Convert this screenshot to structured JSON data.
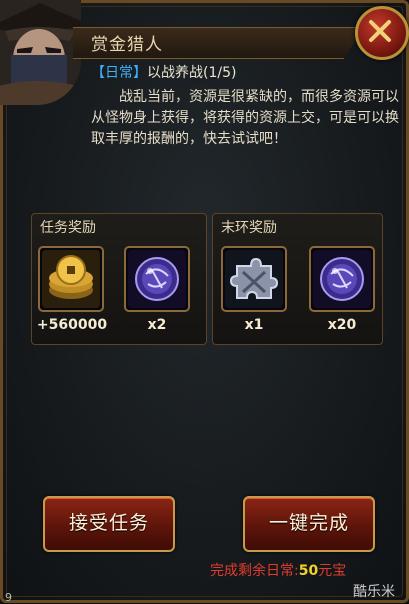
{
  "header": {
    "title": "赏金猎人"
  },
  "quest": {
    "type": "【日常】",
    "name": "以战养战",
    "progress": "(1/5)",
    "description": "战乱当前，资源是很紧缺的，而很多资源可以从怪物身上获得，将获得的资源上交，可是可以换取丰厚的报酬的，快去试试吧！"
  },
  "rewards": {
    "task": {
      "title": "任务奖励",
      "items": [
        {
          "icon": "gold-coin-icon",
          "quantity": "+560000"
        },
        {
          "icon": "purple-orb-icon",
          "quantity": "x2"
        }
      ]
    },
    "final": {
      "title": "末环奖励",
      "items": [
        {
          "icon": "puzzle-piece-icon",
          "quantity": "x1"
        },
        {
          "icon": "purple-orb-icon",
          "quantity": "x20"
        }
      ]
    }
  },
  "buttons": {
    "accept": "接受任务",
    "complete": "一键完成"
  },
  "footer": {
    "note_prefix": "完成剩余日常:",
    "amount": "50",
    "currency": "元宝"
  },
  "watermark": "酷乐米",
  "corner_number": "9",
  "colors": {
    "accent_gold": "#b8923a",
    "quest_type_blue": "#3fb0ff",
    "button_red": "#8a2514"
  }
}
